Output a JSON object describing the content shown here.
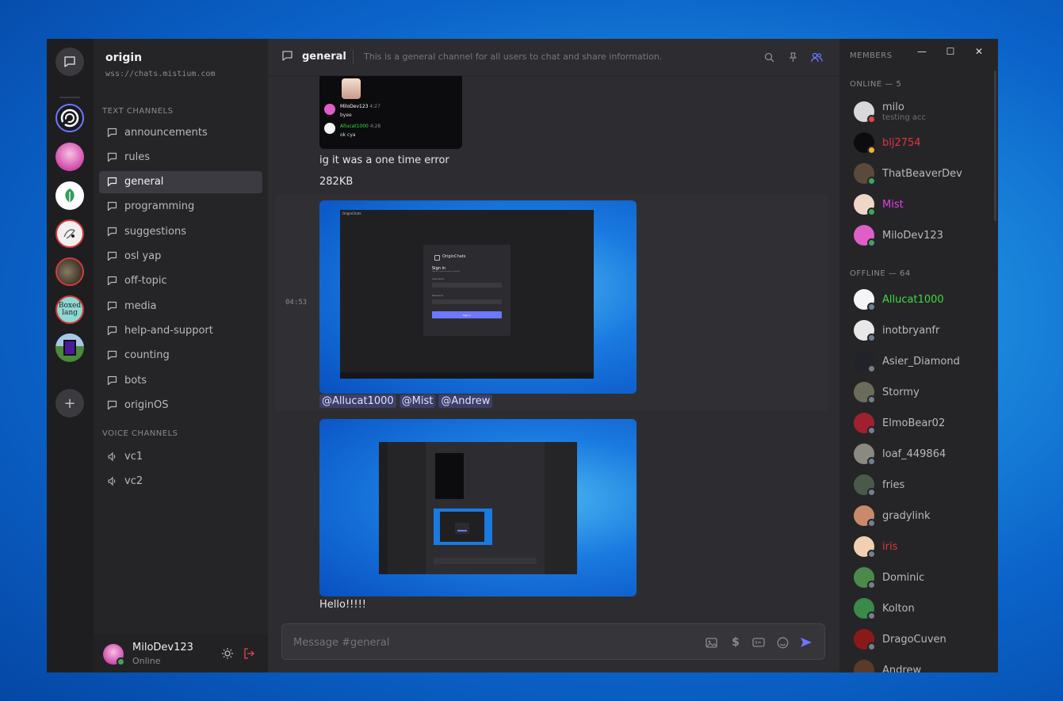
{
  "server": {
    "name": "origin",
    "url": "wss://chats.mistium.com"
  },
  "categories": {
    "text": "TEXT CHANNELS",
    "voice": "VOICE CHANNELS"
  },
  "text_channels": [
    "announcements",
    "rules",
    "general",
    "programming",
    "suggestions",
    "osl yap",
    "off-topic",
    "media",
    "help-and-support",
    "counting",
    "bots",
    "originOS"
  ],
  "voice_channels": [
    "vc1",
    "vc2"
  ],
  "active_channel": "general",
  "header": {
    "channel": "general",
    "description": "This is a general channel for all users to chat and share information."
  },
  "messages": {
    "embed_lines": [
      {
        "user": "MiloDev123",
        "time": "4:27",
        "text": "byee"
      },
      {
        "user": "Allucat1000",
        "time": "4:28",
        "text": "ok cya"
      }
    ],
    "line1": "ig it was a one time error",
    "line2": "282KB",
    "timestamp": "04:53",
    "mentions": [
      "@Allucat1000",
      "@Mist",
      "@Andrew"
    ],
    "line3": "Hello!!!!!",
    "signin_card": {
      "window_title": "OriginChats",
      "app_title": "OriginChats",
      "heading": "Sign in",
      "subtitle": "Sign in to your account to continue",
      "username_label": "Username",
      "password_label": "Password",
      "button": "Sign in"
    }
  },
  "composer": {
    "placeholder": "Message #general"
  },
  "current_user": {
    "name": "MiloDev123",
    "status": "Online"
  },
  "members": {
    "title": "MEMBERS",
    "online_label": "ONLINE — 5",
    "offline_label": "OFFLINE — 64",
    "online": [
      {
        "name": "milo",
        "sub": "testing acc",
        "color": "#b9b9be",
        "status": "#e0484e",
        "avatar": "#d9d9dd"
      },
      {
        "name": "blj2754",
        "color": "#e0353b",
        "status": "#f0b232",
        "avatar": "#0c0c0c"
      },
      {
        "name": "ThatBeaverDev",
        "color": "#b9b9be",
        "status": "#3ba55d",
        "avatar": "#5a4a3a"
      },
      {
        "name": "Mist",
        "color": "#e040e0",
        "status": "#3ba55d",
        "avatar": "#f0d6c8"
      },
      {
        "name": "MiloDev123",
        "color": "#b9b9be",
        "status": "#3ba55d",
        "avatar": "#e05ec8"
      }
    ],
    "offline": [
      {
        "name": "Allucat1000",
        "color": "#3cdc3c",
        "avatar": "#f5f5f5"
      },
      {
        "name": "inotbryanfr",
        "color": "#b9b9be",
        "avatar": "#e8e8e8"
      },
      {
        "name": "Asier_Diamond",
        "color": "#b9b9be",
        "avatar": "#22222a"
      },
      {
        "name": "Stormy",
        "color": "#b9b9be",
        "avatar": "#6b6b5a"
      },
      {
        "name": "ElmoBear02",
        "color": "#b9b9be",
        "avatar": "#a02030"
      },
      {
        "name": "loaf_449864",
        "color": "#b9b9be",
        "avatar": "#8a8a80"
      },
      {
        "name": "fries",
        "color": "#b9b9be",
        "avatar": "#4a5a4a"
      },
      {
        "name": "gradylink",
        "color": "#b9b9be",
        "avatar": "#c88a6a"
      },
      {
        "name": "iris",
        "color": "#e0353b",
        "avatar": "#f0d0b0"
      },
      {
        "name": "Dominic",
        "color": "#b9b9be",
        "avatar": "#4a8a4a"
      },
      {
        "name": "Kolton",
        "color": "#b9b9be",
        "avatar": "#3a8a4a"
      },
      {
        "name": "DragoCuven",
        "color": "#b9b9be",
        "avatar": "#8a1a1a"
      },
      {
        "name": "Andrew",
        "color": "#b9b9be",
        "avatar": "#5a3a2a"
      }
    ]
  },
  "window_controls": {
    "minimize": "—",
    "maximize": "☐",
    "close": "✕"
  },
  "accent": "#6b78ff"
}
